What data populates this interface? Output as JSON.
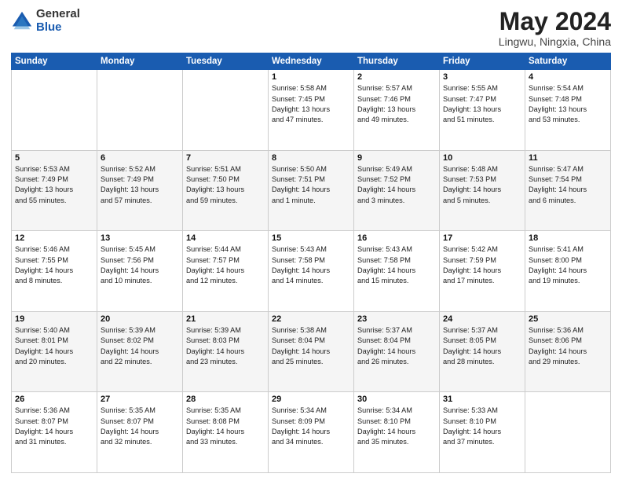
{
  "logo": {
    "general": "General",
    "blue": "Blue"
  },
  "title": "May 2024",
  "subtitle": "Lingwu, Ningxia, China",
  "days": [
    "Sunday",
    "Monday",
    "Tuesday",
    "Wednesday",
    "Thursday",
    "Friday",
    "Saturday"
  ],
  "rows": [
    [
      {
        "num": "",
        "info": ""
      },
      {
        "num": "",
        "info": ""
      },
      {
        "num": "",
        "info": ""
      },
      {
        "num": "1",
        "info": "Sunrise: 5:58 AM\nSunset: 7:45 PM\nDaylight: 13 hours\nand 47 minutes."
      },
      {
        "num": "2",
        "info": "Sunrise: 5:57 AM\nSunset: 7:46 PM\nDaylight: 13 hours\nand 49 minutes."
      },
      {
        "num": "3",
        "info": "Sunrise: 5:55 AM\nSunset: 7:47 PM\nDaylight: 13 hours\nand 51 minutes."
      },
      {
        "num": "4",
        "info": "Sunrise: 5:54 AM\nSunset: 7:48 PM\nDaylight: 13 hours\nand 53 minutes."
      }
    ],
    [
      {
        "num": "5",
        "info": "Sunrise: 5:53 AM\nSunset: 7:49 PM\nDaylight: 13 hours\nand 55 minutes."
      },
      {
        "num": "6",
        "info": "Sunrise: 5:52 AM\nSunset: 7:49 PM\nDaylight: 13 hours\nand 57 minutes."
      },
      {
        "num": "7",
        "info": "Sunrise: 5:51 AM\nSunset: 7:50 PM\nDaylight: 13 hours\nand 59 minutes."
      },
      {
        "num": "8",
        "info": "Sunrise: 5:50 AM\nSunset: 7:51 PM\nDaylight: 14 hours\nand 1 minute."
      },
      {
        "num": "9",
        "info": "Sunrise: 5:49 AM\nSunset: 7:52 PM\nDaylight: 14 hours\nand 3 minutes."
      },
      {
        "num": "10",
        "info": "Sunrise: 5:48 AM\nSunset: 7:53 PM\nDaylight: 14 hours\nand 5 minutes."
      },
      {
        "num": "11",
        "info": "Sunrise: 5:47 AM\nSunset: 7:54 PM\nDaylight: 14 hours\nand 6 minutes."
      }
    ],
    [
      {
        "num": "12",
        "info": "Sunrise: 5:46 AM\nSunset: 7:55 PM\nDaylight: 14 hours\nand 8 minutes."
      },
      {
        "num": "13",
        "info": "Sunrise: 5:45 AM\nSunset: 7:56 PM\nDaylight: 14 hours\nand 10 minutes."
      },
      {
        "num": "14",
        "info": "Sunrise: 5:44 AM\nSunset: 7:57 PM\nDaylight: 14 hours\nand 12 minutes."
      },
      {
        "num": "15",
        "info": "Sunrise: 5:43 AM\nSunset: 7:58 PM\nDaylight: 14 hours\nand 14 minutes."
      },
      {
        "num": "16",
        "info": "Sunrise: 5:43 AM\nSunset: 7:58 PM\nDaylight: 14 hours\nand 15 minutes."
      },
      {
        "num": "17",
        "info": "Sunrise: 5:42 AM\nSunset: 7:59 PM\nDaylight: 14 hours\nand 17 minutes."
      },
      {
        "num": "18",
        "info": "Sunrise: 5:41 AM\nSunset: 8:00 PM\nDaylight: 14 hours\nand 19 minutes."
      }
    ],
    [
      {
        "num": "19",
        "info": "Sunrise: 5:40 AM\nSunset: 8:01 PM\nDaylight: 14 hours\nand 20 minutes."
      },
      {
        "num": "20",
        "info": "Sunrise: 5:39 AM\nSunset: 8:02 PM\nDaylight: 14 hours\nand 22 minutes."
      },
      {
        "num": "21",
        "info": "Sunrise: 5:39 AM\nSunset: 8:03 PM\nDaylight: 14 hours\nand 23 minutes."
      },
      {
        "num": "22",
        "info": "Sunrise: 5:38 AM\nSunset: 8:04 PM\nDaylight: 14 hours\nand 25 minutes."
      },
      {
        "num": "23",
        "info": "Sunrise: 5:37 AM\nSunset: 8:04 PM\nDaylight: 14 hours\nand 26 minutes."
      },
      {
        "num": "24",
        "info": "Sunrise: 5:37 AM\nSunset: 8:05 PM\nDaylight: 14 hours\nand 28 minutes."
      },
      {
        "num": "25",
        "info": "Sunrise: 5:36 AM\nSunset: 8:06 PM\nDaylight: 14 hours\nand 29 minutes."
      }
    ],
    [
      {
        "num": "26",
        "info": "Sunrise: 5:36 AM\nSunset: 8:07 PM\nDaylight: 14 hours\nand 31 minutes."
      },
      {
        "num": "27",
        "info": "Sunrise: 5:35 AM\nSunset: 8:07 PM\nDaylight: 14 hours\nand 32 minutes."
      },
      {
        "num": "28",
        "info": "Sunrise: 5:35 AM\nSunset: 8:08 PM\nDaylight: 14 hours\nand 33 minutes."
      },
      {
        "num": "29",
        "info": "Sunrise: 5:34 AM\nSunset: 8:09 PM\nDaylight: 14 hours\nand 34 minutes."
      },
      {
        "num": "30",
        "info": "Sunrise: 5:34 AM\nSunset: 8:10 PM\nDaylight: 14 hours\nand 35 minutes."
      },
      {
        "num": "31",
        "info": "Sunrise: 5:33 AM\nSunset: 8:10 PM\nDaylight: 14 hours\nand 37 minutes."
      },
      {
        "num": "",
        "info": ""
      }
    ]
  ]
}
